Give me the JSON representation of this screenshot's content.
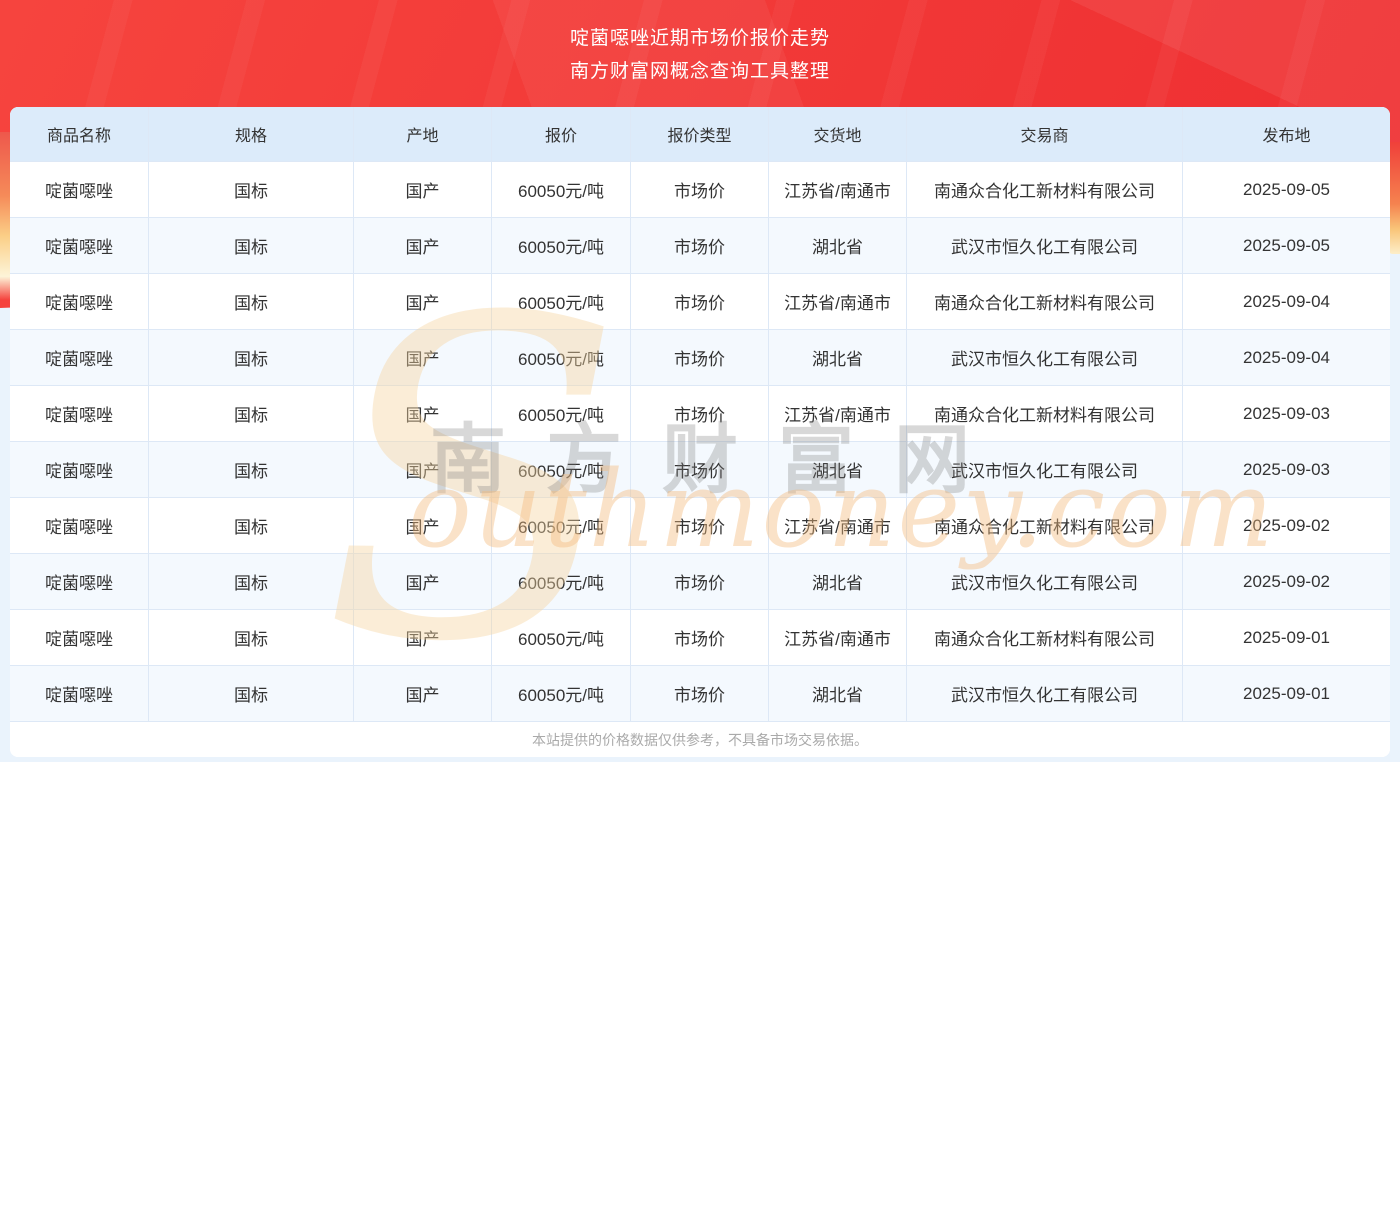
{
  "header": {
    "title": "啶菌噁唑近期市场价报价走势",
    "subtitle": "南方财富网概念查询工具整理"
  },
  "watermark": {
    "big_letter": "S",
    "cn": "南方财富网",
    "en": "outhmoney.com"
  },
  "table": {
    "columns": [
      "商品名称",
      "规格",
      "产地",
      "报价",
      "报价类型",
      "交货地",
      "交易商",
      "发布地"
    ],
    "rows": [
      [
        "啶菌噁唑",
        "国标",
        "国产",
        "60050元/吨",
        "市场价",
        "江苏省/南通市",
        "南通众合化工新材料有限公司",
        "2025-09-05"
      ],
      [
        "啶菌噁唑",
        "国标",
        "国产",
        "60050元/吨",
        "市场价",
        "湖北省",
        "武汉市恒久化工有限公司",
        "2025-09-05"
      ],
      [
        "啶菌噁唑",
        "国标",
        "国产",
        "60050元/吨",
        "市场价",
        "江苏省/南通市",
        "南通众合化工新材料有限公司",
        "2025-09-04"
      ],
      [
        "啶菌噁唑",
        "国标",
        "国产",
        "60050元/吨",
        "市场价",
        "湖北省",
        "武汉市恒久化工有限公司",
        "2025-09-04"
      ],
      [
        "啶菌噁唑",
        "国标",
        "国产",
        "60050元/吨",
        "市场价",
        "江苏省/南通市",
        "南通众合化工新材料有限公司",
        "2025-09-03"
      ],
      [
        "啶菌噁唑",
        "国标",
        "国产",
        "60050元/吨",
        "市场价",
        "湖北省",
        "武汉市恒久化工有限公司",
        "2025-09-03"
      ],
      [
        "啶菌噁唑",
        "国标",
        "国产",
        "60050元/吨",
        "市场价",
        "江苏省/南通市",
        "南通众合化工新材料有限公司",
        "2025-09-02"
      ],
      [
        "啶菌噁唑",
        "国标",
        "国产",
        "60050元/吨",
        "市场价",
        "湖北省",
        "武汉市恒久化工有限公司",
        "2025-09-02"
      ],
      [
        "啶菌噁唑",
        "国标",
        "国产",
        "60050元/吨",
        "市场价",
        "江苏省/南通市",
        "南通众合化工新材料有限公司",
        "2025-09-01"
      ],
      [
        "啶菌噁唑",
        "国标",
        "国产",
        "60050元/吨",
        "市场价",
        "湖北省",
        "武汉市恒久化工有限公司",
        "2025-09-01"
      ]
    ]
  },
  "footer": {
    "disclaimer": "本站提供的价格数据仅供参考，不具备市场交易依据。"
  },
  "colors": {
    "banner_red": "#f23a38",
    "hero_background": "#eaf3fc",
    "header_row_bg": "#dcebfa",
    "alt_row_bg": "#f4f9fe",
    "cell_border": "#dde8f6",
    "cell_text": "#333333",
    "disclaimer_text": "#aaaaaa",
    "title_text": "#ffffff"
  }
}
